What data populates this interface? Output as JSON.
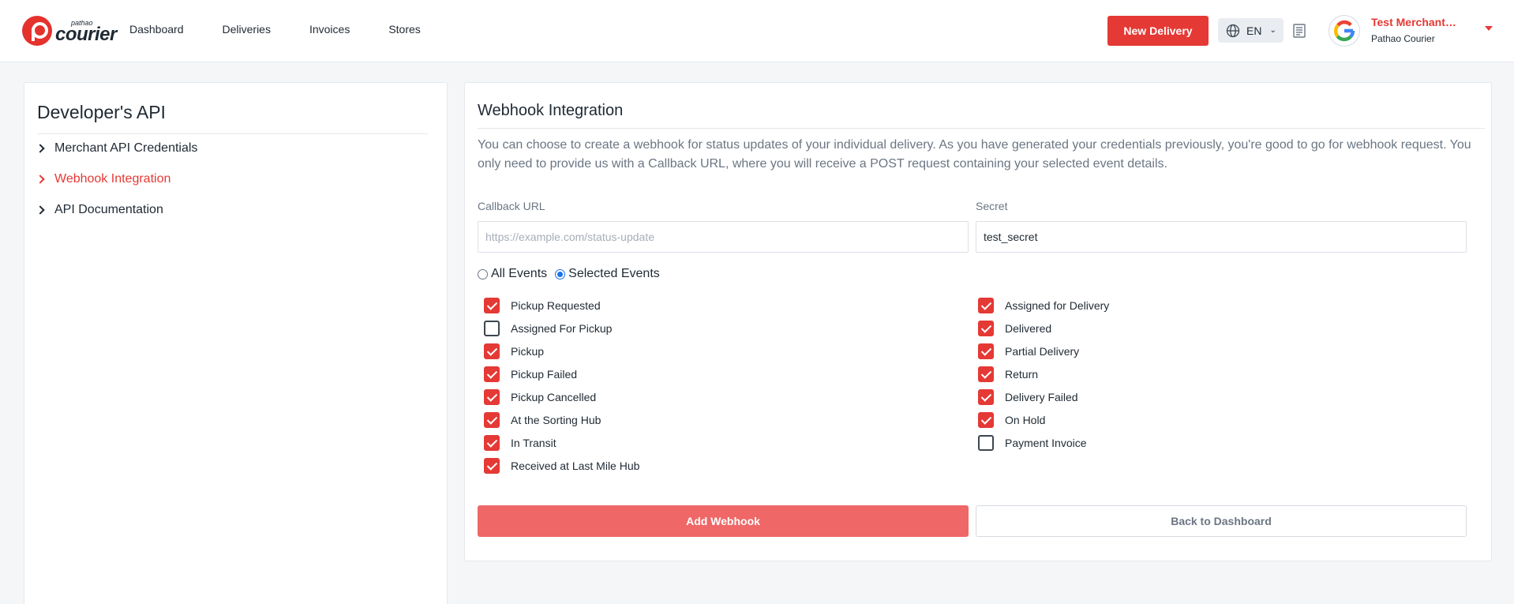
{
  "header": {
    "logo_small": "pathao",
    "logo_big": "courier",
    "nav": [
      "Dashboard",
      "Deliveries",
      "Invoices",
      "Stores"
    ],
    "new_delivery_label": "New Delivery",
    "language": "EN",
    "user_name": "Test Merchant (Do...",
    "user_sub": "Pathao Courier",
    "brand_color": "#e53935"
  },
  "sidebar": {
    "title": "Developer's API",
    "items": [
      {
        "label": "Merchant API Credentials",
        "active": false
      },
      {
        "label": "Webhook Integration",
        "active": true
      },
      {
        "label": "API Documentation",
        "active": false
      }
    ]
  },
  "webhook": {
    "title": "Webhook Integration",
    "description": "You can choose to create a webhook for status updates of your individual delivery. As you have generated your credentials previously, you're good to go for webhook request. You only need to provide us with a Callback URL, where you will receive a POST request containing your selected event details.",
    "callback_label": "Callback URL",
    "callback_placeholder": "https://example.com/status-update",
    "callback_value": "",
    "secret_label": "Secret",
    "secret_value": "test_secret",
    "radio_all": "All Events",
    "radio_selected": "Selected Events",
    "selected_mode": "selected",
    "events_left": [
      {
        "label": "Pickup Requested",
        "checked": true
      },
      {
        "label": "Assigned For Pickup",
        "checked": false
      },
      {
        "label": "Pickup",
        "checked": true
      },
      {
        "label": "Pickup Failed",
        "checked": true
      },
      {
        "label": "Pickup Cancelled",
        "checked": true
      },
      {
        "label": "At the Sorting Hub",
        "checked": true
      },
      {
        "label": "In Transit",
        "checked": true
      },
      {
        "label": "Received at Last Mile Hub",
        "checked": true
      }
    ],
    "events_right": [
      {
        "label": "Assigned for Delivery",
        "checked": true
      },
      {
        "label": "Delivered",
        "checked": true
      },
      {
        "label": "Partial Delivery",
        "checked": true
      },
      {
        "label": "Return",
        "checked": true
      },
      {
        "label": "Delivery Failed",
        "checked": true
      },
      {
        "label": "On Hold",
        "checked": true
      },
      {
        "label": "Payment Invoice",
        "checked": false
      }
    ],
    "add_label": "Add Webhook",
    "back_label": "Back to Dashboard"
  }
}
